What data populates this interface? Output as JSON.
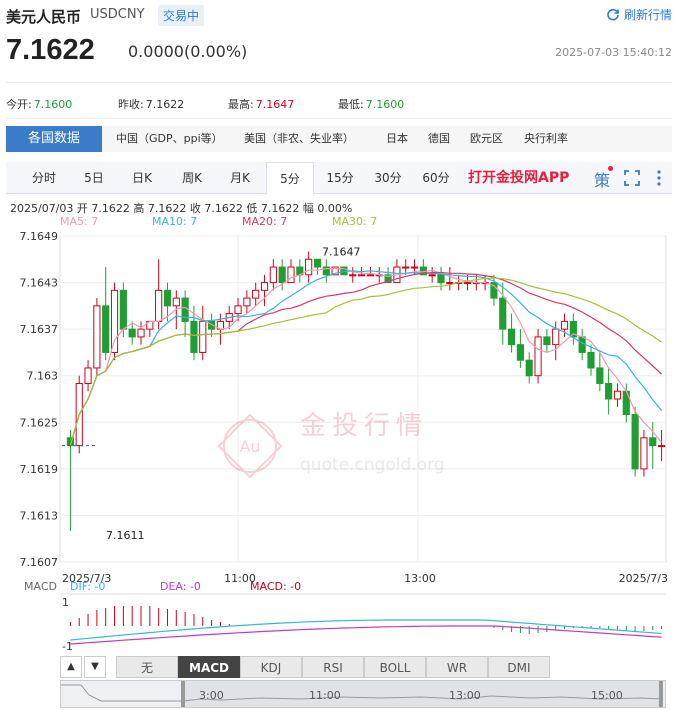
{
  "header": {
    "title": "美元人民币",
    "code": "USDCNY",
    "status": "交易中",
    "refresh_label": "刷新行情",
    "price": "7.1622",
    "change": "0.0000(0.00%)",
    "timestamp": "2025-07-03 15:40:12"
  },
  "stats": [
    {
      "label": "今开:",
      "value": "7.1600"
    },
    {
      "label": "昨收:",
      "value": "7.1622"
    },
    {
      "label": "最高:",
      "value": "7.1647"
    },
    {
      "label": "最低:",
      "value": "7.1600"
    }
  ],
  "categories": {
    "active": "各国数据",
    "items": [
      "中国（GDP、ppi等）",
      "美国（非农、失业率）",
      "日本",
      "德国",
      "欧元区",
      "央行利率"
    ]
  },
  "periods": [
    "分时",
    "5日",
    "日K",
    "周K",
    "月K",
    "5分",
    "15分",
    "30分",
    "60分"
  ],
  "active_period": "5分",
  "promo": "打开金投网APP",
  "icons": {
    "strategy": "策",
    "fullscreen": "fullscreen-icon",
    "more": "more-icon"
  },
  "bar_info": "2025/07/03  开 7.1622  高 7.1622  收 7.1622  低 7.1622  幅 0.00%",
  "ma_labels": [
    "MA5: 7",
    "MA10: 7",
    "MA20: 7",
    "MA30: 7"
  ],
  "colors": {
    "ma5": "#f29ab2",
    "ma10": "#37b6d6",
    "ma20": "#d9386a",
    "ma30": "#a3c33a",
    "up": "#d0021b",
    "down": "#1f9e33"
  },
  "y_ticks": [
    "7.1649",
    "7.1643",
    "7.1637",
    "7.163",
    "7.1625",
    "7.1619",
    "7.1613",
    "7.1607"
  ],
  "x_ticks": [
    "2025/7/3",
    "11:00",
    "13:00",
    "2025/7/3"
  ],
  "annotations": {
    "high": "7.1647",
    "low": "7.1611"
  },
  "watermark": {
    "cn": "金投行情",
    "en": "quote.cngold.org",
    "logo": "Au"
  },
  "macd": {
    "title": "MACD",
    "dif": "DIF: -0",
    "dea": "DEA: -0",
    "macd": "MACD: -0",
    "ticks": [
      "1",
      "-1"
    ]
  },
  "indicator_tabs": [
    "无",
    "MACD",
    "KDJ",
    "RSI",
    "BOLL",
    "WR",
    "DMI"
  ],
  "active_indicator": "MACD",
  "navigator_ticks": [
    "3:00",
    "11:00",
    "13:00",
    "15:00"
  ],
  "chart_data": {
    "type": "candlestick",
    "ylim": [
      7.1607,
      7.1649
    ],
    "candles": [
      [
        7.1623,
        7.1624,
        7.1611,
        7.1622
      ],
      [
        7.1622,
        7.1631,
        7.1621,
        7.163
      ],
      [
        7.163,
        7.1633,
        7.1629,
        7.1632
      ],
      [
        7.1632,
        7.1641,
        7.1631,
        7.164
      ],
      [
        7.164,
        7.1645,
        7.1633,
        7.1634
      ],
      [
        7.1634,
        7.1643,
        7.1633,
        7.1642
      ],
      [
        7.1642,
        7.1643,
        7.1636,
        7.1637
      ],
      [
        7.1637,
        7.1638,
        7.1635,
        7.1636
      ],
      [
        7.1636,
        7.1638,
        7.1635,
        7.1637
      ],
      [
        7.1637,
        7.1638,
        7.1636,
        7.1638
      ],
      [
        7.1638,
        7.1646,
        7.1637,
        7.1642
      ],
      [
        7.1642,
        7.1643,
        7.1638,
        7.164
      ],
      [
        7.164,
        7.1642,
        7.1637,
        7.1641
      ],
      [
        7.1641,
        7.1642,
        7.1636,
        7.1638
      ],
      [
        7.1638,
        7.164,
        7.1633,
        7.1634
      ],
      [
        7.1634,
        7.164,
        7.1633,
        7.1638
      ],
      [
        7.1638,
        7.1639,
        7.1636,
        7.1637
      ],
      [
        7.1637,
        7.1639,
        7.1635,
        7.1638
      ],
      [
        7.1638,
        7.164,
        7.1637,
        7.1639
      ],
      [
        7.1639,
        7.1641,
        7.1638,
        7.164
      ],
      [
        7.164,
        7.1642,
        7.1639,
        7.1641
      ],
      [
        7.1641,
        7.1643,
        7.164,
        7.1642
      ],
      [
        7.1642,
        7.1644,
        7.164,
        7.1643
      ],
      [
        7.1643,
        7.1646,
        7.1642,
        7.1645
      ],
      [
        7.1645,
        7.1646,
        7.1642,
        7.1643
      ],
      [
        7.1643,
        7.1646,
        7.1643,
        7.1645
      ],
      [
        7.1645,
        7.1646,
        7.1643,
        7.1644
      ],
      [
        7.1644,
        7.1647,
        7.1643,
        7.1646
      ],
      [
        7.1646,
        7.1646,
        7.1644,
        7.1645
      ],
      [
        7.1645,
        7.1646,
        7.1643,
        7.1644
      ],
      [
        7.1644,
        7.1645,
        7.1644,
        7.1645
      ],
      [
        7.1645,
        7.1645,
        7.1644,
        7.1644
      ],
      [
        7.1644,
        7.1645,
        7.1643,
        7.1644
      ],
      [
        7.1644,
        7.1645,
        7.1644,
        7.1644
      ],
      [
        7.1644,
        7.1645,
        7.1644,
        7.1644
      ],
      [
        7.1644,
        7.1645,
        7.1643,
        7.1644
      ],
      [
        7.1644,
        7.1645,
        7.1643,
        7.1643
      ],
      [
        7.1643,
        7.1646,
        7.1643,
        7.1645
      ],
      [
        7.1645,
        7.1646,
        7.1644,
        7.1645
      ],
      [
        7.1645,
        7.1646,
        7.1644,
        7.1645
      ],
      [
        7.1645,
        7.1646,
        7.1644,
        7.1644
      ],
      [
        7.1644,
        7.1645,
        7.1643,
        7.1644
      ],
      [
        7.1644,
        7.1645,
        7.1642,
        7.1643
      ],
      [
        7.1643,
        7.1645,
        7.1642,
        7.1643
      ],
      [
        7.1643,
        7.1644,
        7.1642,
        7.1643
      ],
      [
        7.1643,
        7.1644,
        7.1642,
        7.1643
      ],
      [
        7.1643,
        7.1644,
        7.1642,
        7.1643
      ],
      [
        7.1643,
        7.1644,
        7.1642,
        7.1643
      ],
      [
        7.1643,
        7.1644,
        7.164,
        7.1641
      ],
      [
        7.1641,
        7.1643,
        7.1635,
        7.1637
      ],
      [
        7.1637,
        7.1639,
        7.1634,
        7.1635
      ],
      [
        7.1635,
        7.1637,
        7.1632,
        7.1633
      ],
      [
        7.1633,
        7.1634,
        7.163,
        7.1631
      ],
      [
        7.1631,
        7.1637,
        7.163,
        7.1636
      ],
      [
        7.1636,
        7.1637,
        7.1634,
        7.1635
      ],
      [
        7.1635,
        7.1638,
        7.1633,
        7.1637
      ],
      [
        7.1637,
        7.1639,
        7.1636,
        7.1638
      ],
      [
        7.1638,
        7.1639,
        7.1635,
        7.1636
      ],
      [
        7.1636,
        7.1637,
        7.1633,
        7.1634
      ],
      [
        7.1634,
        7.1635,
        7.1631,
        7.1632
      ],
      [
        7.1632,
        7.1634,
        7.1629,
        7.163
      ],
      [
        7.163,
        7.1632,
        7.1626,
        7.1628
      ],
      [
        7.1628,
        7.163,
        7.1627,
        7.1629
      ],
      [
        7.1629,
        7.163,
        7.1625,
        7.1626
      ],
      [
        7.1626,
        7.1627,
        7.1618,
        7.1619
      ],
      [
        7.1619,
        7.1624,
        7.1618,
        7.1623
      ],
      [
        7.1623,
        7.1625,
        7.1619,
        7.1622
      ],
      [
        7.1622,
        7.1624,
        7.162,
        7.1622
      ]
    ]
  }
}
